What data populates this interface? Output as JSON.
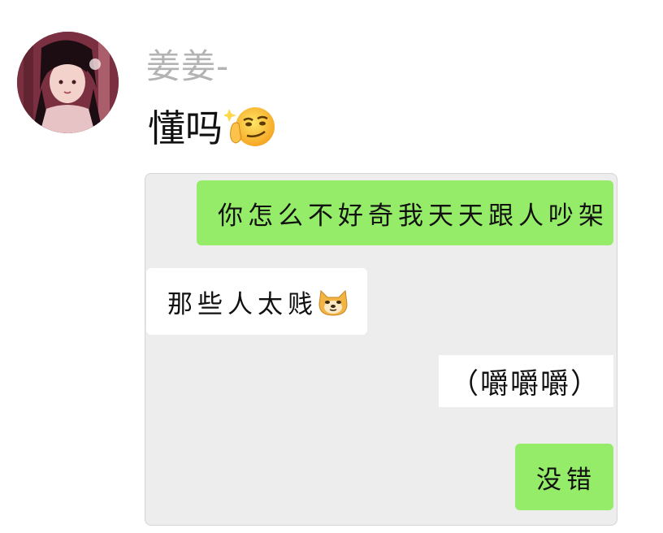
{
  "post": {
    "sender_name": "姜姜-",
    "message_text": "懂吗",
    "message_emoji": "smirk-face-icon"
  },
  "embedded_chat": {
    "messages": [
      {
        "side": "right",
        "style": "green",
        "text": "你怎么不好奇我天天跟人吵架"
      },
      {
        "side": "left",
        "style": "white",
        "text": "那些人太贱",
        "emoji": "doge-icon"
      },
      {
        "side": "right",
        "style": "white",
        "text": "（嚼嚼嚼）"
      },
      {
        "side": "right",
        "style": "green",
        "text": "没错"
      }
    ]
  },
  "colors": {
    "green_bubble": "#95ec69",
    "card_background": "#ededed",
    "name_gray": "#b3b3b3"
  }
}
